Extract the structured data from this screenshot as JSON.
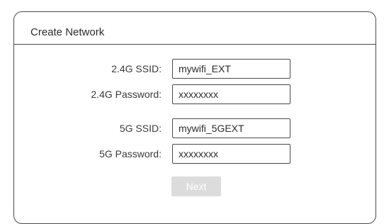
{
  "panel": {
    "title": "Create Network"
  },
  "fields": [
    {
      "label": "2.4G SSID:",
      "value": "mywifi_EXT"
    },
    {
      "label": "2.4G Password:",
      "value": "xxxxxxxx"
    },
    {
      "label": "5G SSID:",
      "value": "mywifi_5GEXT"
    },
    {
      "label": "5G Password:",
      "value": "xxxxxxxx"
    }
  ],
  "actions": {
    "next_label": "Next"
  }
}
